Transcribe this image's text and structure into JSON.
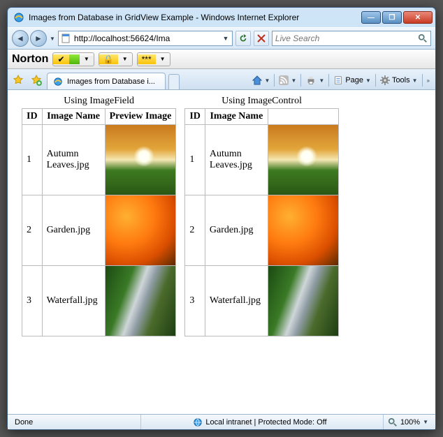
{
  "window": {
    "title": "Images from Database in GridView Example - Windows Internet Explorer"
  },
  "nav": {
    "url": "http://localhost:56624/Ima",
    "search_placeholder": "Live Search"
  },
  "norton": {
    "brand": "Norton",
    "stars": "***"
  },
  "tabbar": {
    "active_tab": "Images from Database i...",
    "page_label": "Page",
    "tools_label": "Tools"
  },
  "page": {
    "grid1": {
      "title": "Using ImageField",
      "headers": {
        "id": "ID",
        "name": "Image Name",
        "preview": "Preview Image"
      },
      "rows": [
        {
          "id": "1",
          "name": "Autumn Leaves.jpg",
          "thumb": "autumn"
        },
        {
          "id": "2",
          "name": "Garden.jpg",
          "thumb": "garden"
        },
        {
          "id": "3",
          "name": "Waterfall.jpg",
          "thumb": "waterfall"
        }
      ]
    },
    "grid2": {
      "title": "Using ImageControl",
      "headers": {
        "id": "ID",
        "name": "Image Name"
      },
      "rows": [
        {
          "id": "1",
          "name": "Autumn Leaves.jpg",
          "thumb": "autumn"
        },
        {
          "id": "2",
          "name": "Garden.jpg",
          "thumb": "garden"
        },
        {
          "id": "3",
          "name": "Waterfall.jpg",
          "thumb": "waterfall"
        }
      ]
    }
  },
  "status": {
    "done": "Done",
    "zone": "Local intranet | Protected Mode: Off",
    "zoom": "100%"
  }
}
